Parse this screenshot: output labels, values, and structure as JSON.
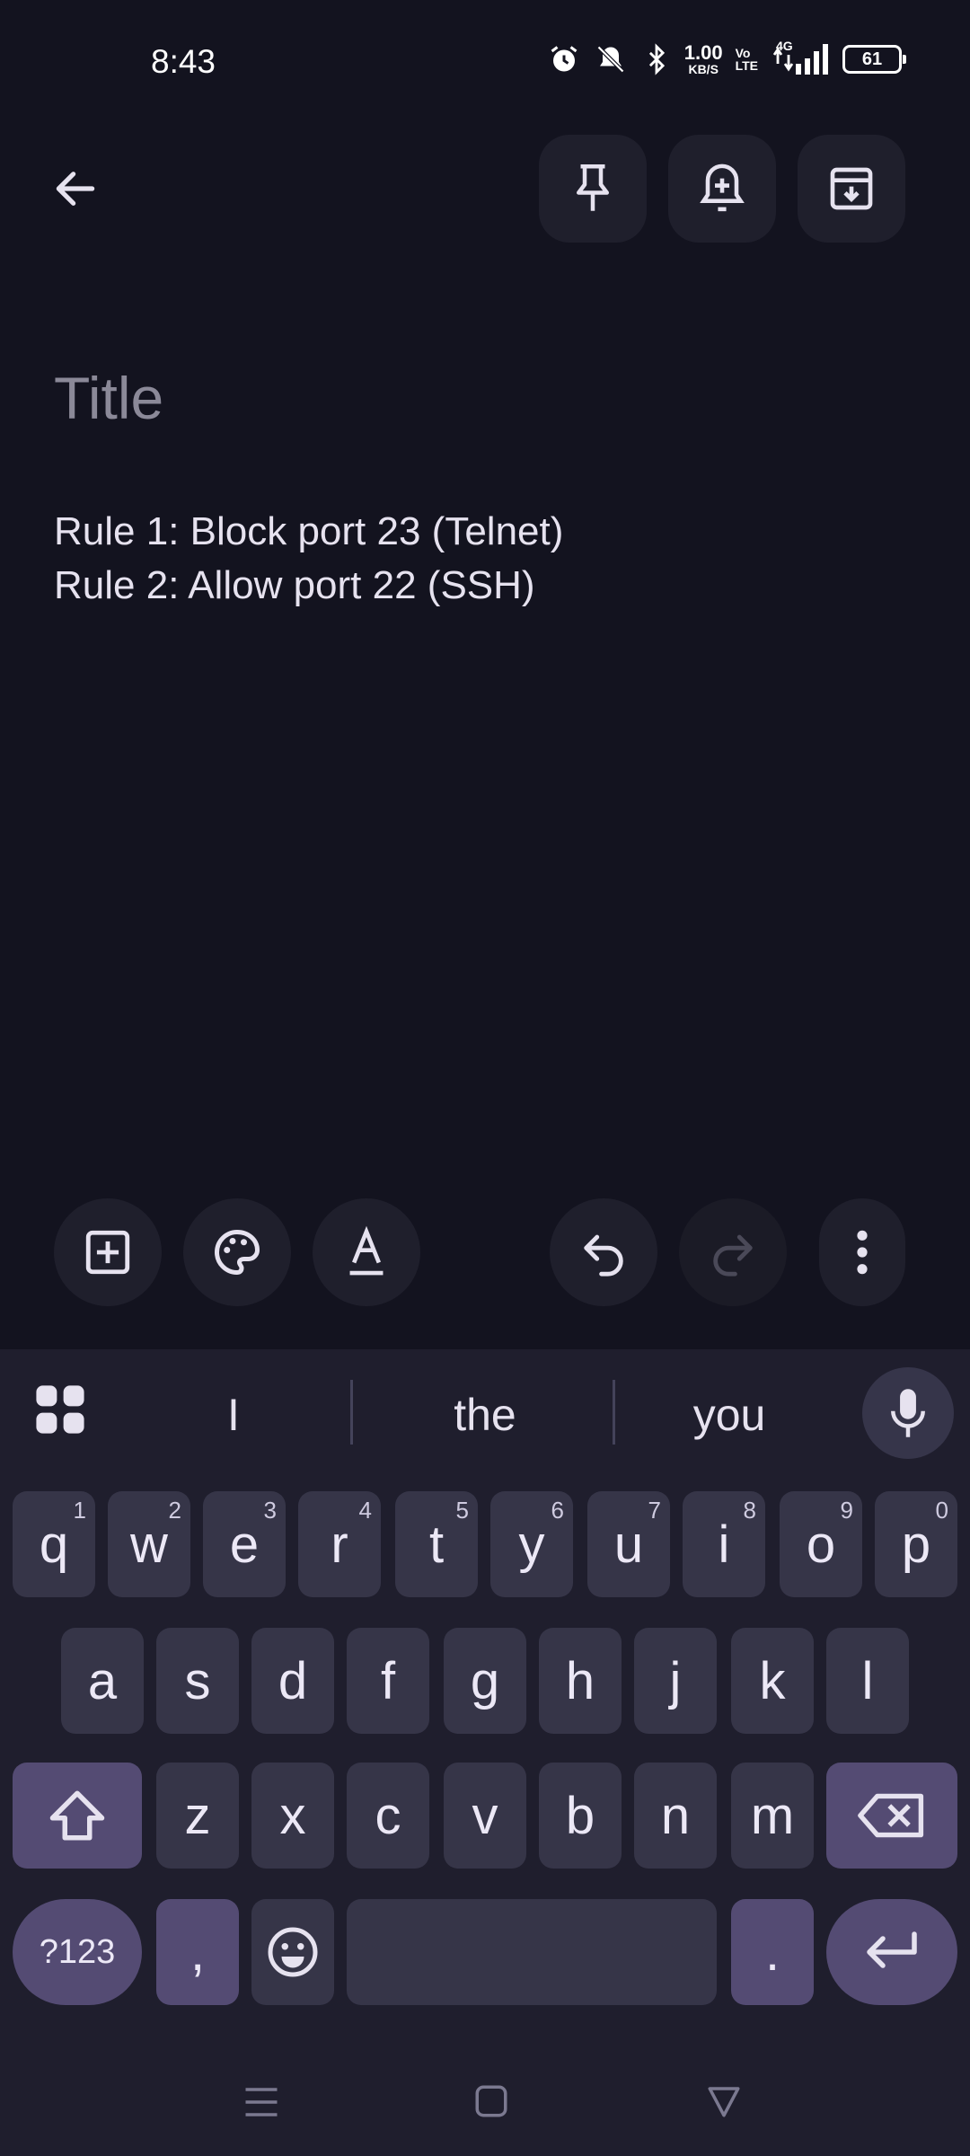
{
  "status_bar": {
    "time": "8:43",
    "net_speed_value": "1.00",
    "net_speed_unit": "KB/S",
    "volte_top": "Vo",
    "volte_bottom": "LTE",
    "network_type": "4G",
    "battery_level": "61"
  },
  "top_bar": {
    "icons": [
      "back-arrow-icon",
      "pin-icon",
      "add-reminder-icon",
      "archive-icon"
    ]
  },
  "note": {
    "title_placeholder": "Title",
    "body": "Rule 1: Block port 23 (Telnet)\nRule 2: Allow port 22 (SSH)"
  },
  "toolbar": {
    "icons": [
      "add-box-icon",
      "palette-icon",
      "text-format-icon",
      "undo-icon",
      "redo-icon",
      "more-vert-icon"
    ]
  },
  "keyboard": {
    "suggestions": [
      "I",
      "the",
      "you"
    ],
    "row1": [
      {
        "key": "q",
        "hint": "1"
      },
      {
        "key": "w",
        "hint": "2"
      },
      {
        "key": "e",
        "hint": "3"
      },
      {
        "key": "r",
        "hint": "4"
      },
      {
        "key": "t",
        "hint": "5"
      },
      {
        "key": "y",
        "hint": "6"
      },
      {
        "key": "u",
        "hint": "7"
      },
      {
        "key": "i",
        "hint": "8"
      },
      {
        "key": "o",
        "hint": "9"
      },
      {
        "key": "p",
        "hint": "0"
      }
    ],
    "row2": [
      "a",
      "s",
      "d",
      "f",
      "g",
      "h",
      "j",
      "k",
      "l"
    ],
    "row3": [
      "z",
      "x",
      "c",
      "v",
      "b",
      "n",
      "m"
    ],
    "symbols_label": "?123",
    "comma_label": ",",
    "period_label": "."
  },
  "colors": {
    "background": "#13131f",
    "keyboard_bg": "#1f1e2d",
    "key_bg": "#363548",
    "accent_key_bg": "#544b73"
  }
}
